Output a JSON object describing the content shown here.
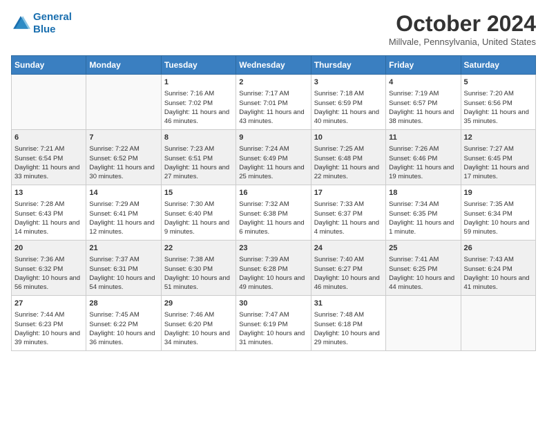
{
  "header": {
    "logo_line1": "General",
    "logo_line2": "Blue",
    "month_title": "October 2024",
    "location": "Millvale, Pennsylvania, United States"
  },
  "weekdays": [
    "Sunday",
    "Monday",
    "Tuesday",
    "Wednesday",
    "Thursday",
    "Friday",
    "Saturday"
  ],
  "weeks": [
    [
      {
        "day": "",
        "sunrise": "",
        "sunset": "",
        "daylight": ""
      },
      {
        "day": "",
        "sunrise": "",
        "sunset": "",
        "daylight": ""
      },
      {
        "day": "1",
        "sunrise": "Sunrise: 7:16 AM",
        "sunset": "Sunset: 7:02 PM",
        "daylight": "Daylight: 11 hours and 46 minutes."
      },
      {
        "day": "2",
        "sunrise": "Sunrise: 7:17 AM",
        "sunset": "Sunset: 7:01 PM",
        "daylight": "Daylight: 11 hours and 43 minutes."
      },
      {
        "day": "3",
        "sunrise": "Sunrise: 7:18 AM",
        "sunset": "Sunset: 6:59 PM",
        "daylight": "Daylight: 11 hours and 40 minutes."
      },
      {
        "day": "4",
        "sunrise": "Sunrise: 7:19 AM",
        "sunset": "Sunset: 6:57 PM",
        "daylight": "Daylight: 11 hours and 38 minutes."
      },
      {
        "day": "5",
        "sunrise": "Sunrise: 7:20 AM",
        "sunset": "Sunset: 6:56 PM",
        "daylight": "Daylight: 11 hours and 35 minutes."
      }
    ],
    [
      {
        "day": "6",
        "sunrise": "Sunrise: 7:21 AM",
        "sunset": "Sunset: 6:54 PM",
        "daylight": "Daylight: 11 hours and 33 minutes."
      },
      {
        "day": "7",
        "sunrise": "Sunrise: 7:22 AM",
        "sunset": "Sunset: 6:52 PM",
        "daylight": "Daylight: 11 hours and 30 minutes."
      },
      {
        "day": "8",
        "sunrise": "Sunrise: 7:23 AM",
        "sunset": "Sunset: 6:51 PM",
        "daylight": "Daylight: 11 hours and 27 minutes."
      },
      {
        "day": "9",
        "sunrise": "Sunrise: 7:24 AM",
        "sunset": "Sunset: 6:49 PM",
        "daylight": "Daylight: 11 hours and 25 minutes."
      },
      {
        "day": "10",
        "sunrise": "Sunrise: 7:25 AM",
        "sunset": "Sunset: 6:48 PM",
        "daylight": "Daylight: 11 hours and 22 minutes."
      },
      {
        "day": "11",
        "sunrise": "Sunrise: 7:26 AM",
        "sunset": "Sunset: 6:46 PM",
        "daylight": "Daylight: 11 hours and 19 minutes."
      },
      {
        "day": "12",
        "sunrise": "Sunrise: 7:27 AM",
        "sunset": "Sunset: 6:45 PM",
        "daylight": "Daylight: 11 hours and 17 minutes."
      }
    ],
    [
      {
        "day": "13",
        "sunrise": "Sunrise: 7:28 AM",
        "sunset": "Sunset: 6:43 PM",
        "daylight": "Daylight: 11 hours and 14 minutes."
      },
      {
        "day": "14",
        "sunrise": "Sunrise: 7:29 AM",
        "sunset": "Sunset: 6:41 PM",
        "daylight": "Daylight: 11 hours and 12 minutes."
      },
      {
        "day": "15",
        "sunrise": "Sunrise: 7:30 AM",
        "sunset": "Sunset: 6:40 PM",
        "daylight": "Daylight: 11 hours and 9 minutes."
      },
      {
        "day": "16",
        "sunrise": "Sunrise: 7:32 AM",
        "sunset": "Sunset: 6:38 PM",
        "daylight": "Daylight: 11 hours and 6 minutes."
      },
      {
        "day": "17",
        "sunrise": "Sunrise: 7:33 AM",
        "sunset": "Sunset: 6:37 PM",
        "daylight": "Daylight: 11 hours and 4 minutes."
      },
      {
        "day": "18",
        "sunrise": "Sunrise: 7:34 AM",
        "sunset": "Sunset: 6:35 PM",
        "daylight": "Daylight: 11 hours and 1 minute."
      },
      {
        "day": "19",
        "sunrise": "Sunrise: 7:35 AM",
        "sunset": "Sunset: 6:34 PM",
        "daylight": "Daylight: 10 hours and 59 minutes."
      }
    ],
    [
      {
        "day": "20",
        "sunrise": "Sunrise: 7:36 AM",
        "sunset": "Sunset: 6:32 PM",
        "daylight": "Daylight: 10 hours and 56 minutes."
      },
      {
        "day": "21",
        "sunrise": "Sunrise: 7:37 AM",
        "sunset": "Sunset: 6:31 PM",
        "daylight": "Daylight: 10 hours and 54 minutes."
      },
      {
        "day": "22",
        "sunrise": "Sunrise: 7:38 AM",
        "sunset": "Sunset: 6:30 PM",
        "daylight": "Daylight: 10 hours and 51 minutes."
      },
      {
        "day": "23",
        "sunrise": "Sunrise: 7:39 AM",
        "sunset": "Sunset: 6:28 PM",
        "daylight": "Daylight: 10 hours and 49 minutes."
      },
      {
        "day": "24",
        "sunrise": "Sunrise: 7:40 AM",
        "sunset": "Sunset: 6:27 PM",
        "daylight": "Daylight: 10 hours and 46 minutes."
      },
      {
        "day": "25",
        "sunrise": "Sunrise: 7:41 AM",
        "sunset": "Sunset: 6:25 PM",
        "daylight": "Daylight: 10 hours and 44 minutes."
      },
      {
        "day": "26",
        "sunrise": "Sunrise: 7:43 AM",
        "sunset": "Sunset: 6:24 PM",
        "daylight": "Daylight: 10 hours and 41 minutes."
      }
    ],
    [
      {
        "day": "27",
        "sunrise": "Sunrise: 7:44 AM",
        "sunset": "Sunset: 6:23 PM",
        "daylight": "Daylight: 10 hours and 39 minutes."
      },
      {
        "day": "28",
        "sunrise": "Sunrise: 7:45 AM",
        "sunset": "Sunset: 6:22 PM",
        "daylight": "Daylight: 10 hours and 36 minutes."
      },
      {
        "day": "29",
        "sunrise": "Sunrise: 7:46 AM",
        "sunset": "Sunset: 6:20 PM",
        "daylight": "Daylight: 10 hours and 34 minutes."
      },
      {
        "day": "30",
        "sunrise": "Sunrise: 7:47 AM",
        "sunset": "Sunset: 6:19 PM",
        "daylight": "Daylight: 10 hours and 31 minutes."
      },
      {
        "day": "31",
        "sunrise": "Sunrise: 7:48 AM",
        "sunset": "Sunset: 6:18 PM",
        "daylight": "Daylight: 10 hours and 29 minutes."
      },
      {
        "day": "",
        "sunrise": "",
        "sunset": "",
        "daylight": ""
      },
      {
        "day": "",
        "sunrise": "",
        "sunset": "",
        "daylight": ""
      }
    ]
  ]
}
